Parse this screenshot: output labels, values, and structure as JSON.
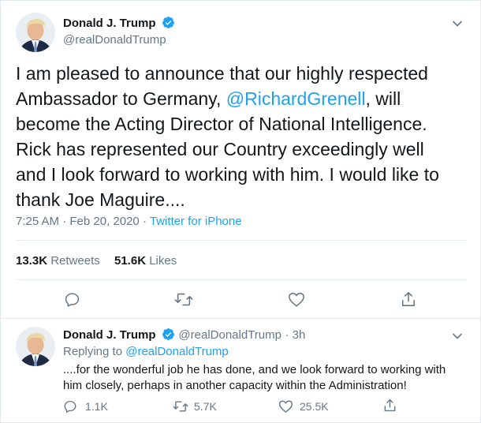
{
  "main_tweet": {
    "author_name": "Donald J. Trump",
    "author_handle": "@realDonaldTrump",
    "text_before_mention": "I am pleased to announce that our highly respected Ambassador to Germany, ",
    "mention": "@RichardGrenell",
    "text_after_mention": ", will become the Acting Director of National Intelligence. Rick has represented our Country exceedingly well and I look forward to working with him. I would like to thank Joe Maguire....",
    "time": "7:25 AM · Feb 20, 2020",
    "separator": " · ",
    "source": "Twitter for iPhone",
    "retweets_count": "13.3K",
    "retweets_label": "Retweets",
    "likes_count": "51.6K",
    "likes_label": "Likes"
  },
  "reply_tweet": {
    "author_name": "Donald J. Trump",
    "author_handle": "@realDonaldTrump",
    "age": "· 3h",
    "replying_prefix": "Replying to ",
    "replying_handle": "@realDonaldTrump",
    "text": "....for the wonderful job he has done, and we look forward to working with him closely, perhaps in another capacity within the Administration!",
    "reply_count": "1.1K",
    "retweet_count": "5.7K",
    "like_count": "25.5K"
  },
  "colors": {
    "accent": "#1da1f2",
    "secondary_text": "#657786",
    "primary_text": "#14171a",
    "divider": "#e6ecf0"
  },
  "icons": [
    "verified-badge-icon",
    "chevron-down-icon",
    "reply-icon",
    "retweet-icon",
    "like-icon",
    "share-icon"
  ]
}
